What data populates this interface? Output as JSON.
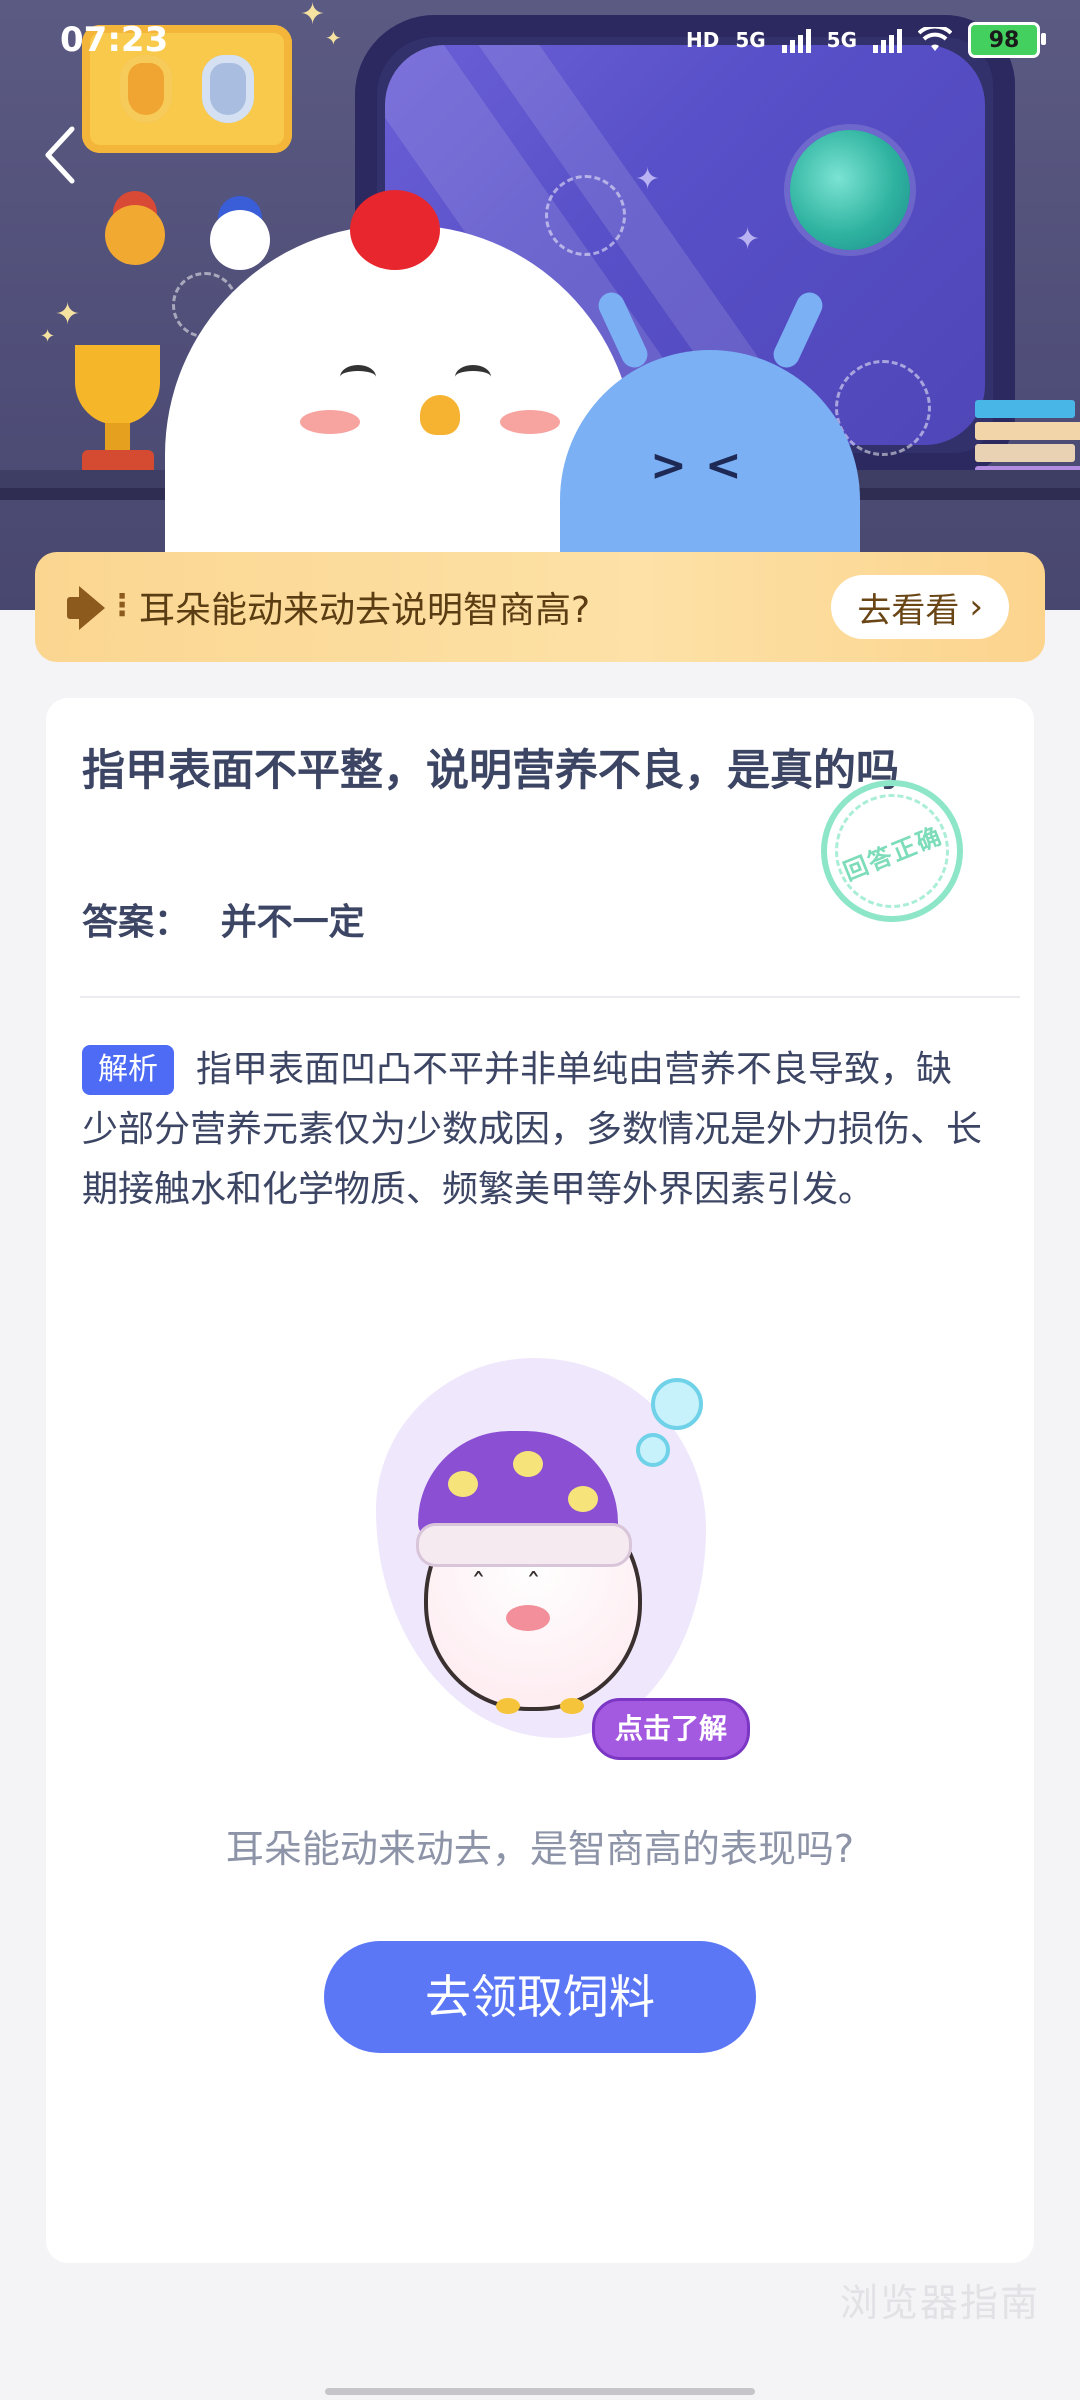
{
  "status_bar": {
    "time": "07:23",
    "hd_label": "HD",
    "net1": "5G",
    "net2": "5G",
    "battery": "98"
  },
  "banner": {
    "text": "耳朵能动来动去说明智商高?",
    "button_label": "去看看",
    "button_chevron": "›"
  },
  "question": {
    "title": "指甲表面不平整，说明营养不良，是真的吗",
    "answer_label": "答案：",
    "answer_value": "并不一定",
    "stamp": "回答正确"
  },
  "analysis": {
    "tag": "解析",
    "text": "指甲表面凹凸不平并非单纯由营养不良导致，缺少部分营养元素仅为少数成因，多数情况是外力损伤、长期接触水和化学物质、频繁美甲等外界因素引发。"
  },
  "promo": {
    "learn_button": "点击了解",
    "related_question": "耳朵能动来动去，是智商高的表现吗?",
    "claim_button": "去领取饲料"
  },
  "watermark": "浏览器指南",
  "icons": {
    "back": "chevron-left-icon",
    "speaker": "megaphone-icon",
    "wifi": "wifi-icon"
  },
  "colors": {
    "accent": "#5b77f6",
    "banner_bg": "#fde1a6",
    "stamp": "#7ddcb9",
    "tag_bg": "#4e6bf5",
    "battery": "#43d05f"
  }
}
